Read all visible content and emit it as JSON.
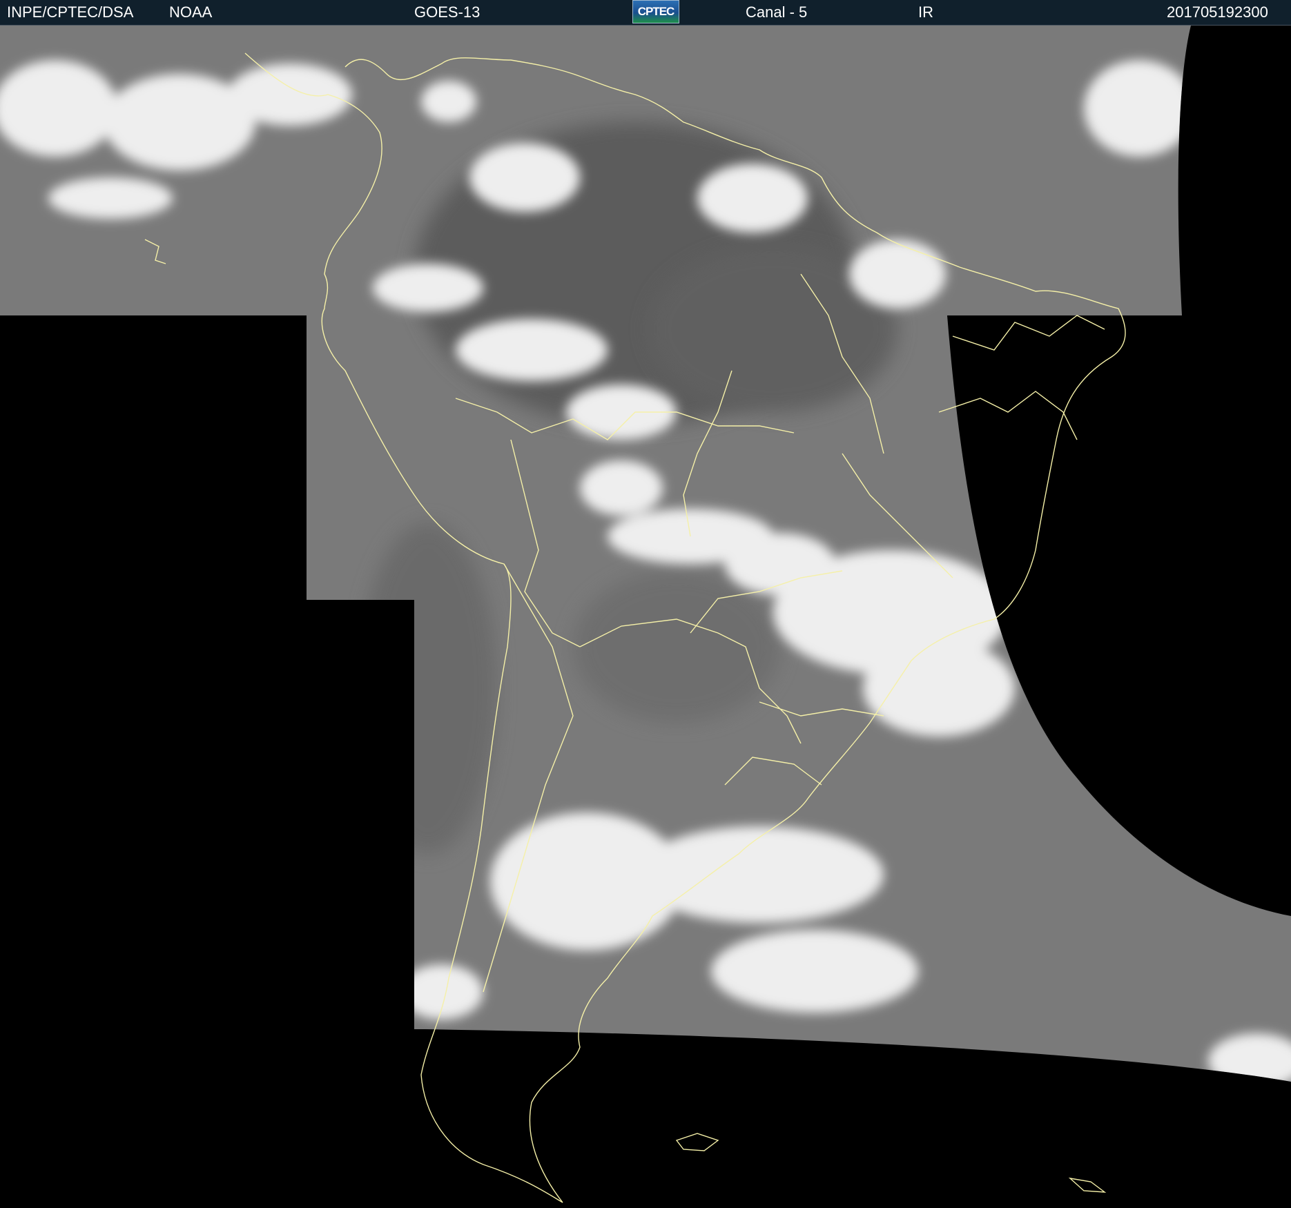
{
  "header": {
    "institution": "INPE/CPTEC/DSA",
    "agency": "NOAA",
    "satellite": "GOES-13",
    "logo_text": "CPTEC",
    "channel": "Canal - 5",
    "band": "IR",
    "timestamp": "201705192300"
  },
  "colors": {
    "header_bg": "#10202c",
    "header_text": "#ffffff",
    "no_data": "#000000",
    "clear_sky": "#7c7c7c",
    "cloud": "#f2f2f2",
    "coastline": "#f5f0a8"
  },
  "map": {
    "projection": "satellite infrared mosaic",
    "region": "South America",
    "borders": "country and state borders drawn in light yellow"
  }
}
